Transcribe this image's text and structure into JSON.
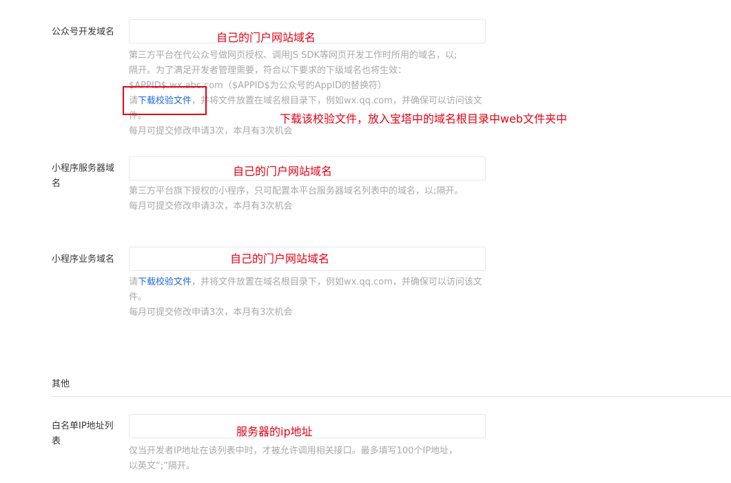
{
  "fields": [
    {
      "label": "公众号开发域名",
      "annotation": "自己的门户网站域名",
      "help_line1": "第三方平台在代公众号做网页授权、调用JS SDK等网页开发工作时所用的域名，以;",
      "help_line2": "隔开。为了满足开发者管理需要，符合以下要求的下级域名也将生效：",
      "help_line3": "$APPID$.wx.abc.com（$APPID$为公众号的AppID的替换符）",
      "help_prefix": "请",
      "help_link": "下载校验文件",
      "help_suffix": "，并将文件放置在域名根目录下，例如wx.qq.com，并确保可以访问该文件。",
      "quota": "每月可提交修改申请3次，本月有3次机会"
    },
    {
      "label": "小程序服务器域名",
      "annotation": "自己的门户网站域名",
      "help_text": "第三方平台旗下授权的小程序，只可配置本平台服务器域名列表中的域名，以;隔开。",
      "quota": "每月可提交修改申请3次，本月有3次机会"
    },
    {
      "label": "小程序业务域名",
      "annotation": "自己的门户网站域名",
      "help_prefix": "请",
      "help_link": "下载校验文件",
      "help_suffix": "，并将文件放置在域名根目录下，例如wx.qq.com，并确保可以访问该文件。",
      "quota": "每月可提交修改申请3次，本月有3次机会"
    }
  ],
  "callout": "下载该校验文件，放入宝塔中的域名根目录中web文件夹中",
  "other_section": {
    "title": "其他",
    "whitelist_label": "白名单IP地址列表",
    "whitelist_annotation": "服务器的ip地址",
    "whitelist_help_line1": "仅当开发者IP地址在该列表中时，才被允许调用相关接口。最多填写100个IP地址，",
    "whitelist_help_line2": "以英文“;”隔开。"
  },
  "colors": {
    "annotation": "#e60012",
    "link": "#1e6bd8",
    "help_text": "#a9a9a9",
    "border": "#e7e7eb"
  }
}
